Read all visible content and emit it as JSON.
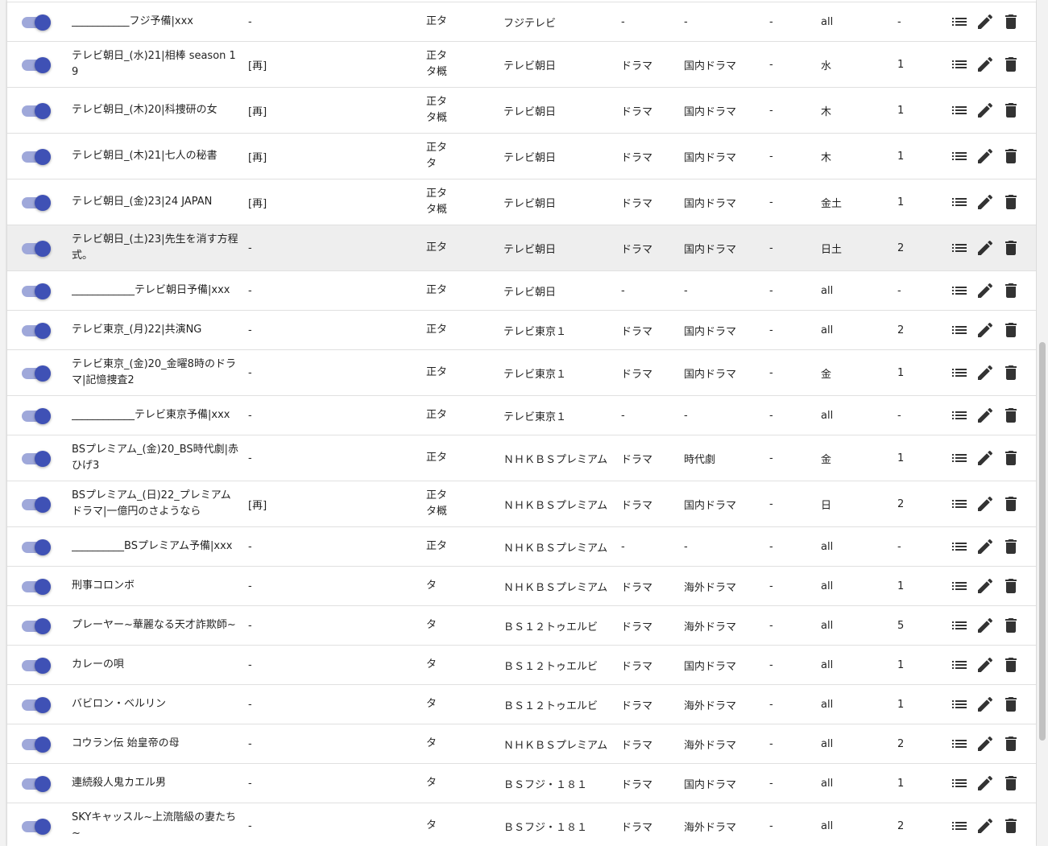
{
  "colors": {
    "toggle_track": "#9fa8da",
    "toggle_thumb": "#3f51b5"
  },
  "rows": [
    {
      "title": "___________フジ予備|xxx",
      "re": "-",
      "type": "正タ",
      "station": "フジテレビ",
      "genre1": "-",
      "genre2": "-",
      "dash": "-",
      "day": "all",
      "count": "-",
      "enabled": true
    },
    {
      "title": "テレビ朝日_(水)21|相棒 season 19",
      "re": "[再]",
      "type": "正タ タ概",
      "station": "テレビ朝日",
      "genre1": "ドラマ",
      "genre2": "国内ドラマ",
      "dash": "-",
      "day": "水",
      "count": "1",
      "enabled": true
    },
    {
      "title": "テレビ朝日_(木)20|科捜研の女",
      "re": "[再]",
      "type": "正タ タ概",
      "station": "テレビ朝日",
      "genre1": "ドラマ",
      "genre2": "国内ドラマ",
      "dash": "-",
      "day": "木",
      "count": "1",
      "enabled": true
    },
    {
      "title": "テレビ朝日_(木)21|七人の秘書",
      "re": "[再]",
      "type": "正タ タ",
      "station": "テレビ朝日",
      "genre1": "ドラマ",
      "genre2": "国内ドラマ",
      "dash": "-",
      "day": "木",
      "count": "1",
      "enabled": true
    },
    {
      "title": "テレビ朝日_(金)23|24 JAPAN",
      "re": "[再]",
      "type": "正タ タ概",
      "station": "テレビ朝日",
      "genre1": "ドラマ",
      "genre2": "国内ドラマ",
      "dash": "-",
      "day": "金土",
      "count": "1",
      "enabled": true
    },
    {
      "title": "テレビ朝日_(土)23|先生を消す方程式。",
      "re": "-",
      "type": "正タ",
      "station": "テレビ朝日",
      "genre1": "ドラマ",
      "genre2": "国内ドラマ",
      "dash": "-",
      "day": "日土",
      "count": "2",
      "enabled": true
    },
    {
      "title": "____________テレビ朝日予備|xxx",
      "re": "-",
      "type": "正タ",
      "station": "テレビ朝日",
      "genre1": "-",
      "genre2": "-",
      "dash": "-",
      "day": "all",
      "count": "-",
      "enabled": true
    },
    {
      "title": "テレビ東京_(月)22|共演NG",
      "re": "-",
      "type": "正タ",
      "station": "テレビ東京１",
      "genre1": "ドラマ",
      "genre2": "国内ドラマ",
      "dash": "-",
      "day": "all",
      "count": "2",
      "enabled": true
    },
    {
      "title": "テレビ東京_(金)20_金曜8時のドラマ|記憶捜査2",
      "re": "-",
      "type": "正タ",
      "station": "テレビ東京１",
      "genre1": "ドラマ",
      "genre2": "国内ドラマ",
      "dash": "-",
      "day": "金",
      "count": "1",
      "enabled": true
    },
    {
      "title": "____________テレビ東京予備|xxx",
      "re": "-",
      "type": "正タ",
      "station": "テレビ東京１",
      "genre1": "-",
      "genre2": "-",
      "dash": "-",
      "day": "all",
      "count": "-",
      "enabled": true
    },
    {
      "title": "BSプレミアム_(金)20_BS時代劇|赤ひげ3",
      "re": "-",
      "type": "正タ",
      "station": "ＮＨＫＢＳプレミアム",
      "genre1": "ドラマ",
      "genre2": "時代劇",
      "dash": "-",
      "day": "金",
      "count": "1",
      "enabled": true
    },
    {
      "title": "BSプレミアム_(日)22_プレミアムドラマ|一億円のさようなら",
      "re": "[再]",
      "type": "正タ タ概",
      "station": "ＮＨＫＢＳプレミアム",
      "genre1": "ドラマ",
      "genre2": "国内ドラマ",
      "dash": "-",
      "day": "日",
      "count": "2",
      "enabled": true
    },
    {
      "title": "__________BSプレミアム予備|xxx",
      "re": "-",
      "type": "正タ",
      "station": "ＮＨＫＢＳプレミアム",
      "genre1": "-",
      "genre2": "-",
      "dash": "-",
      "day": "all",
      "count": "-",
      "enabled": true
    },
    {
      "title": "刑事コロンボ",
      "re": "-",
      "type": "タ",
      "station": "ＮＨＫＢＳプレミアム",
      "genre1": "ドラマ",
      "genre2": "海外ドラマ",
      "dash": "-",
      "day": "all",
      "count": "1",
      "enabled": true
    },
    {
      "title": "プレーヤー~華麗なる天才詐欺師~",
      "re": "-",
      "type": "タ",
      "station": "ＢＳ１２トゥエルビ",
      "genre1": "ドラマ",
      "genre2": "海外ドラマ",
      "dash": "-",
      "day": "all",
      "count": "5",
      "enabled": true
    },
    {
      "title": "カレーの唄",
      "re": "-",
      "type": "タ",
      "station": "ＢＳ１２トゥエルビ",
      "genre1": "ドラマ",
      "genre2": "国内ドラマ",
      "dash": "-",
      "day": "all",
      "count": "1",
      "enabled": true
    },
    {
      "title": "バビロン・ベルリン",
      "re": "-",
      "type": "タ",
      "station": "ＢＳ１２トゥエルビ",
      "genre1": "ドラマ",
      "genre2": "海外ドラマ",
      "dash": "-",
      "day": "all",
      "count": "1",
      "enabled": true
    },
    {
      "title": "コウラン伝 始皇帝の母",
      "re": "-",
      "type": "タ",
      "station": "ＮＨＫＢＳプレミアム",
      "genre1": "ドラマ",
      "genre2": "海外ドラマ",
      "dash": "-",
      "day": "all",
      "count": "2",
      "enabled": true
    },
    {
      "title": "連続殺人鬼カエル男",
      "re": "-",
      "type": "タ",
      "station": "ＢＳフジ・１８１",
      "genre1": "ドラマ",
      "genre2": "国内ドラマ",
      "dash": "-",
      "day": "all",
      "count": "1",
      "enabled": true
    },
    {
      "title": "SKYキャッスル~上流階級の妻たち~",
      "re": "-",
      "type": "タ",
      "station": "ＢＳフジ・１８１",
      "genre1": "ドラマ",
      "genre2": "海外ドラマ",
      "dash": "-",
      "day": "all",
      "count": "2",
      "enabled": true
    }
  ]
}
